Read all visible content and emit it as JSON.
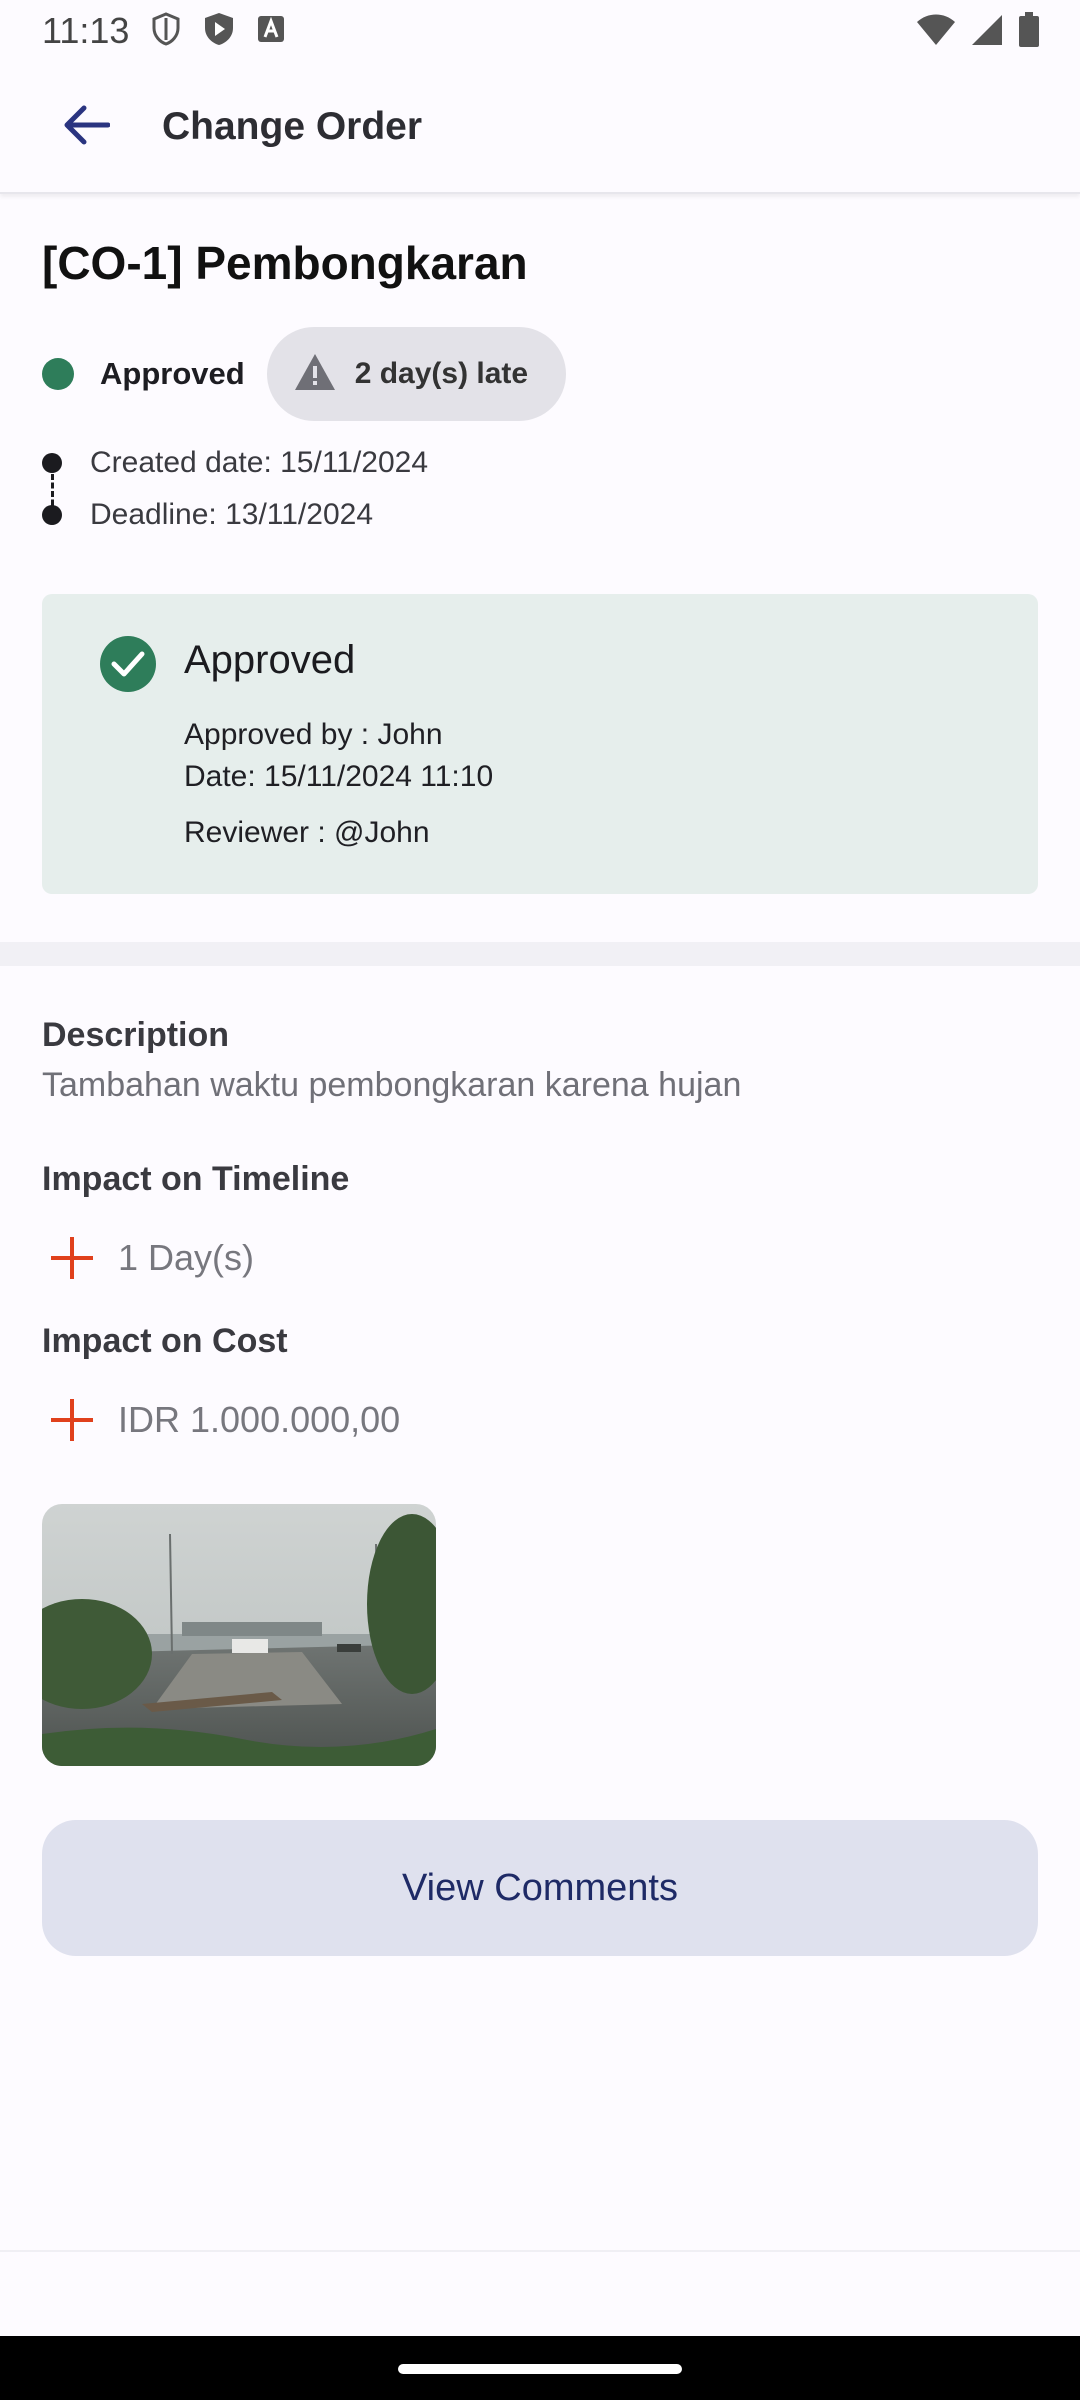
{
  "status_bar": {
    "time": "11:13",
    "left_icons": [
      "shield-icon",
      "play-protect-icon",
      "font-icon"
    ],
    "right_icons": [
      "wifi-icon",
      "signal-icon",
      "battery-icon"
    ]
  },
  "app_bar": {
    "title": "Change Order",
    "back_icon": "arrow-back-icon"
  },
  "order": {
    "title": "[CO-1] Pembongkaran",
    "status": "Approved",
    "status_color": "#2e7d5a",
    "late_label": "2 day(s) late",
    "created_date": "Created date: 15/11/2024",
    "deadline": "Deadline: 13/11/2024"
  },
  "approval": {
    "title": "Approved",
    "approved_by": "Approved by : John",
    "date": "Date: 15/11/2024 11:10",
    "reviewer": "Reviewer : @John"
  },
  "details": {
    "description_label": "Description",
    "description_value": "Tambahan waktu pembongkaran karena hujan",
    "timeline_label": "Impact on Timeline",
    "timeline_value": "1 Day(s)",
    "cost_label": "Impact on Cost",
    "cost_value": "IDR 1.000.000,00",
    "accent_color": "#e0401c"
  },
  "actions": {
    "view_comments": "View Comments"
  }
}
